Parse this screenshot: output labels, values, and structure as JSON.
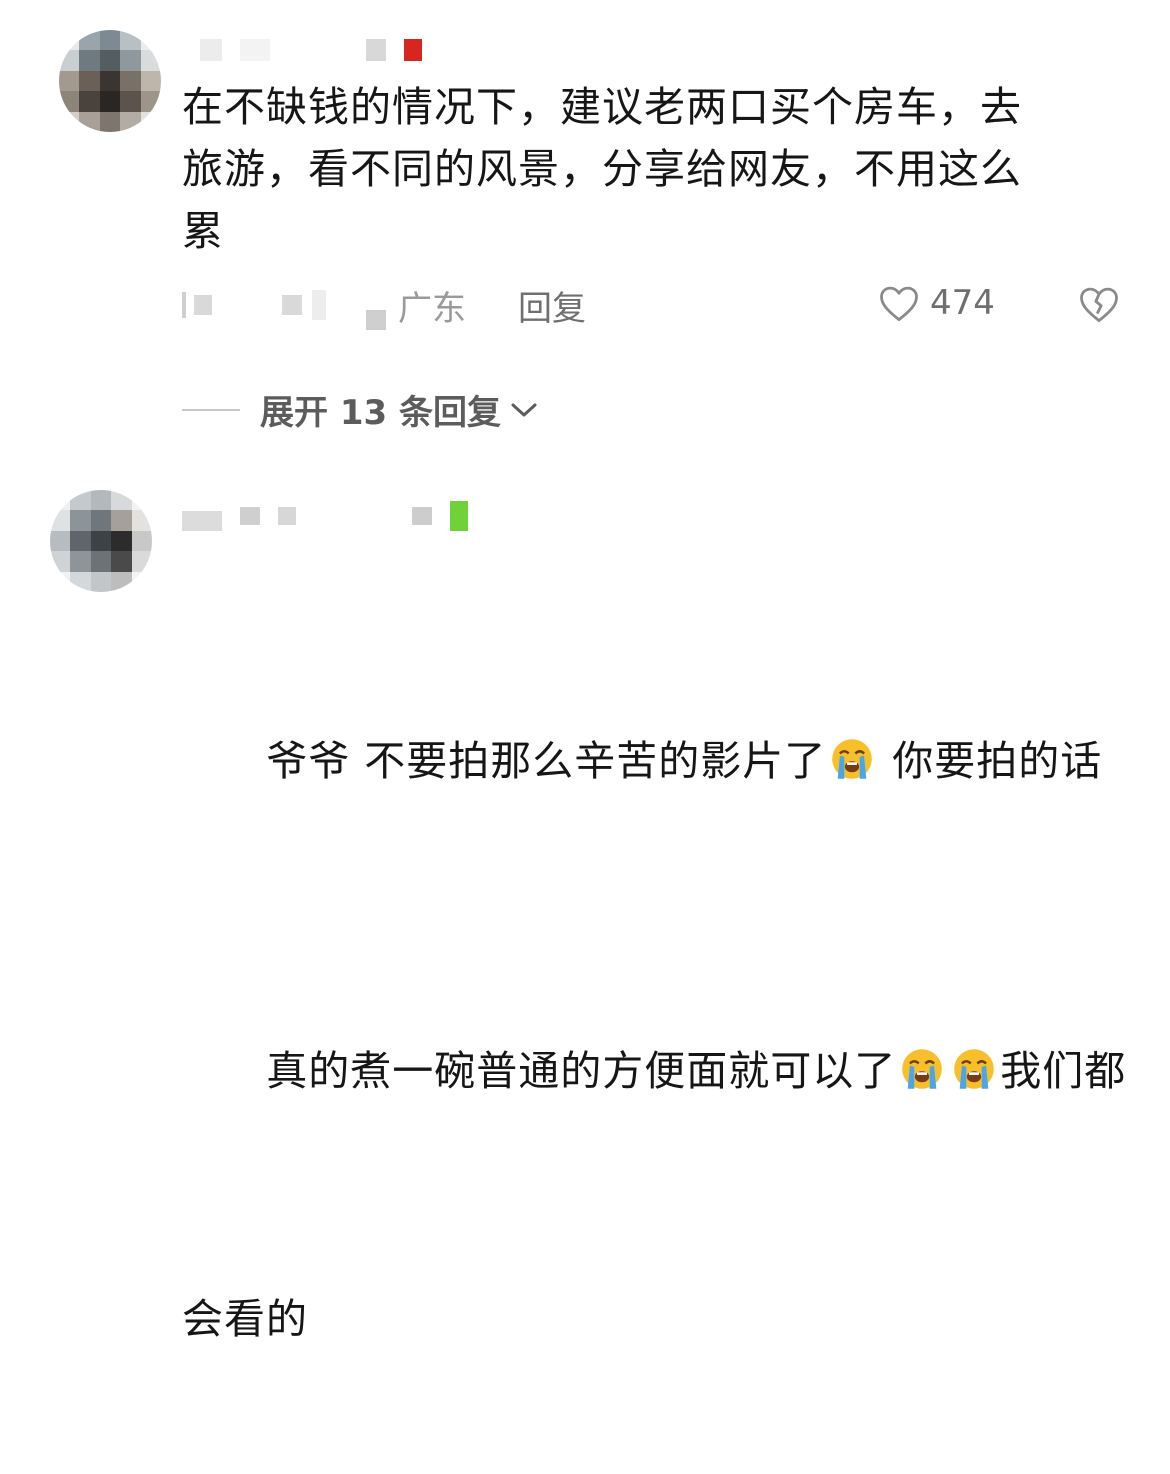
{
  "comments": [
    {
      "username": "",
      "text": "在不缺钱的情况下，建议老两口买个房车，去\n旅游，看不同的风景，分享给网友，不用这么\n累",
      "region": "广东",
      "reply_label": "回复",
      "likes": "474",
      "avatar_icon": "pixelated-avatar",
      "like_icon": "heart-outline-icon",
      "dislike_icon": "broken-heart-icon"
    },
    {
      "username": "",
      "line1_part1": "爷爷 不要拍那么辛苦的影片了",
      "line1_part2": " 你要拍的话",
      "line2_part1": "真的煮一碗普通的方便面就可以了",
      "line2_part2": "我们都",
      "line3": "会看的",
      "emoji_name": "loudly-crying-face-emoji",
      "avatar_icon": "pixelated-avatar",
      "badge_icon": "clover-badge-icon"
    }
  ],
  "expand_replies": {
    "label": "展开 13 条回复",
    "icon": "chevron-down-icon"
  },
  "colors": {
    "text": "#161616",
    "meta": "#6f6f6f",
    "region": "#9a9a9a",
    "badge_red": "#d7261f",
    "badge_green": "#6fd23a"
  }
}
